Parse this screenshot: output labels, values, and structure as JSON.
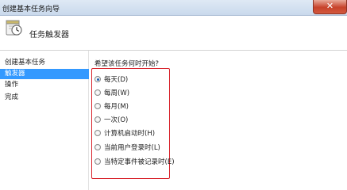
{
  "window": {
    "title": "创建基本任务向导",
    "close_label": "✕"
  },
  "header": {
    "title": "任务触发器",
    "icon": "task-clock-icon"
  },
  "nav": {
    "items": [
      {
        "label": "创建基本任务",
        "active": false
      },
      {
        "label": "触发器",
        "active": true
      },
      {
        "label": "操作",
        "active": false
      },
      {
        "label": "完成",
        "active": false
      }
    ]
  },
  "main": {
    "question": "希望该任务何时开始?",
    "options": [
      {
        "label": "每天(D)",
        "selected": true
      },
      {
        "label": "每周(W)",
        "selected": false
      },
      {
        "label": "每月(M)",
        "selected": false
      },
      {
        "label": "一次(O)",
        "selected": false
      },
      {
        "label": "计算机启动时(H)",
        "selected": false
      },
      {
        "label": "当前用户登录时(L)",
        "selected": false
      },
      {
        "label": "当特定事件被记录时(E)",
        "selected": false
      }
    ]
  },
  "colors": {
    "selection": "#3399ff",
    "highlight_border": "#d8222a",
    "close_button": "#c7432b"
  }
}
